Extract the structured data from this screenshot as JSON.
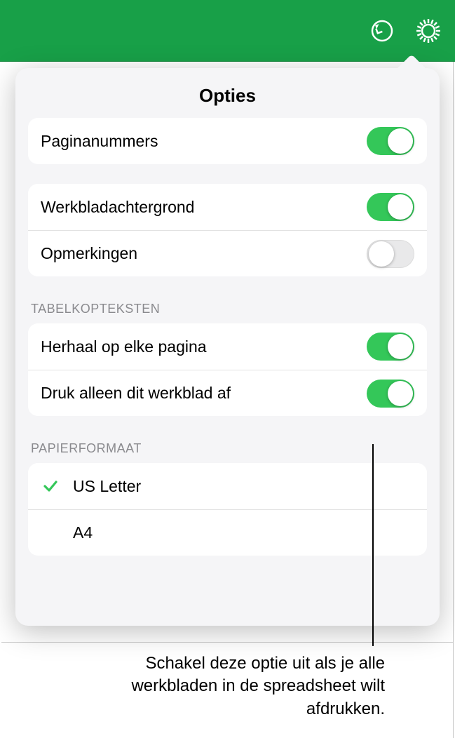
{
  "toolbar": {
    "undo_icon": "undo",
    "settings_icon": "settings-gear"
  },
  "popover": {
    "title": "Opties",
    "group1": [
      {
        "label": "Paginanummers",
        "on": true
      }
    ],
    "group2": [
      {
        "label": "Werkbladachtergrond",
        "on": true
      },
      {
        "label": "Opmerkingen",
        "on": false
      }
    ],
    "headers_section": {
      "title": "TABELKOPTEKSTEN",
      "rows": [
        {
          "label": "Herhaal op elke pagina",
          "on": true
        },
        {
          "label": "Druk alleen dit werkblad af",
          "on": true
        }
      ]
    },
    "paper_section": {
      "title": "PAPIERFORMAAT",
      "options": [
        {
          "label": "US Letter",
          "selected": true
        },
        {
          "label": "A4",
          "selected": false
        }
      ]
    }
  },
  "callout": "Schakel deze optie uit als je alle werkbladen in de spreadsheet wilt afdrukken."
}
